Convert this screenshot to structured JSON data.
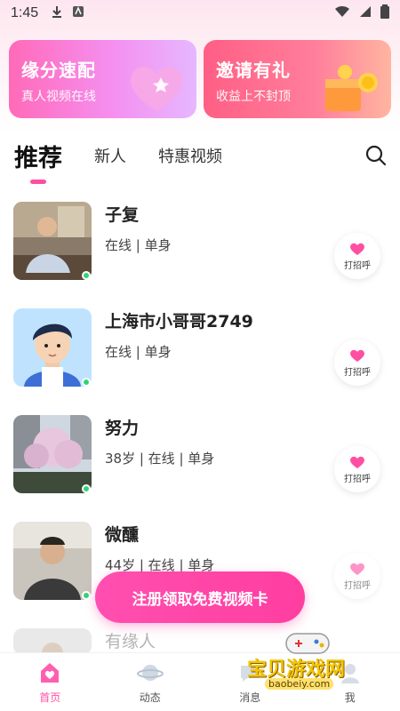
{
  "status_bar": {
    "time": "1:45"
  },
  "banners": [
    {
      "title": "缘分速配",
      "subtitle": "真人视频在线"
    },
    {
      "title": "邀请有礼",
      "subtitle": "收益上不封顶"
    }
  ],
  "tabs": [
    {
      "label": "推荐",
      "active": true
    },
    {
      "label": "新人",
      "active": false
    },
    {
      "label": "特惠视频",
      "active": false
    }
  ],
  "users": [
    {
      "name": "子复",
      "meta": "在线 | 单身",
      "greet": "打招呼"
    },
    {
      "name": "上海市小哥哥2749",
      "meta": "在线 | 单身",
      "greet": "打招呼"
    },
    {
      "name": "努力",
      "meta": "38岁 | 在线 | 单身",
      "greet": "打招呼"
    },
    {
      "name": "微醺",
      "meta": "44岁 | 在线 | 单身",
      "greet": "打招呼"
    },
    {
      "name": "有缘人",
      "meta": "",
      "greet": ""
    }
  ],
  "cta": {
    "label": "注册领取免费视频卡"
  },
  "bottom_nav": [
    {
      "label": "首页",
      "icon": "home-icon",
      "active": true
    },
    {
      "label": "动态",
      "icon": "planet-icon",
      "active": false
    },
    {
      "label": "消息",
      "icon": "message-icon",
      "active": false
    },
    {
      "label": "我",
      "icon": "profile-icon",
      "active": false
    }
  ],
  "watermark": {
    "text": "宝贝游戏网",
    "url": "baobeiy.com"
  },
  "colors": {
    "accent": "#ff4fa3",
    "online": "#2ed573"
  }
}
